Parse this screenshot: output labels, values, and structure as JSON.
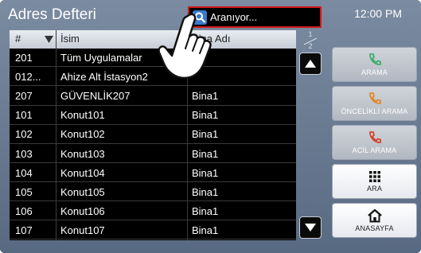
{
  "header": {
    "title": "Adres Defteri",
    "clock": "12:00 PM"
  },
  "search": {
    "placeholder": "Aranıyor..."
  },
  "table": {
    "columns": {
      "number": "#",
      "name": "İsim",
      "building": "Bina Adı"
    },
    "rows": [
      {
        "number": "201",
        "name": "Tüm Uygulamalar",
        "building": ""
      },
      {
        "number": "012...",
        "name": "Ahize Alt İstasyon2",
        "building": ""
      },
      {
        "number": "207",
        "name": "GÜVENLİK207",
        "building": "Bina1"
      },
      {
        "number": "101",
        "name": "Konut101",
        "building": "Bina1"
      },
      {
        "number": "102",
        "name": "Konut102",
        "building": "Bina1"
      },
      {
        "number": "103",
        "name": "Konut103",
        "building": "Bina1"
      },
      {
        "number": "104",
        "name": "Konut104",
        "building": "Bina1"
      },
      {
        "number": "105",
        "name": "Konut105",
        "building": "Bina1"
      },
      {
        "number": "106",
        "name": "Konut106",
        "building": "Bina1"
      },
      {
        "number": "107",
        "name": "Konut107",
        "building": "Bina1"
      }
    ]
  },
  "pagination": {
    "current": "1",
    "total": "2"
  },
  "actions": {
    "call": "ARAMA",
    "priority_call": "ÖNCELİKLİ ARAMA",
    "emergency_call": "ACİL ARAMA",
    "dial": "ARA",
    "home": "ANASAYFA"
  },
  "colors": {
    "accent_red": "#d01818",
    "call_green": "#3fae6a",
    "priority_orange": "#e08a28",
    "emergency_red": "#d2452e"
  },
  "icons": {
    "search": "search-icon",
    "sort": "sort-down-icon",
    "scroll_up": "arrow-up-icon",
    "scroll_down": "arrow-down-icon",
    "phone": "phone-icon",
    "keypad": "keypad-icon",
    "home": "home-icon",
    "hand": "hand-pointer-icon"
  }
}
